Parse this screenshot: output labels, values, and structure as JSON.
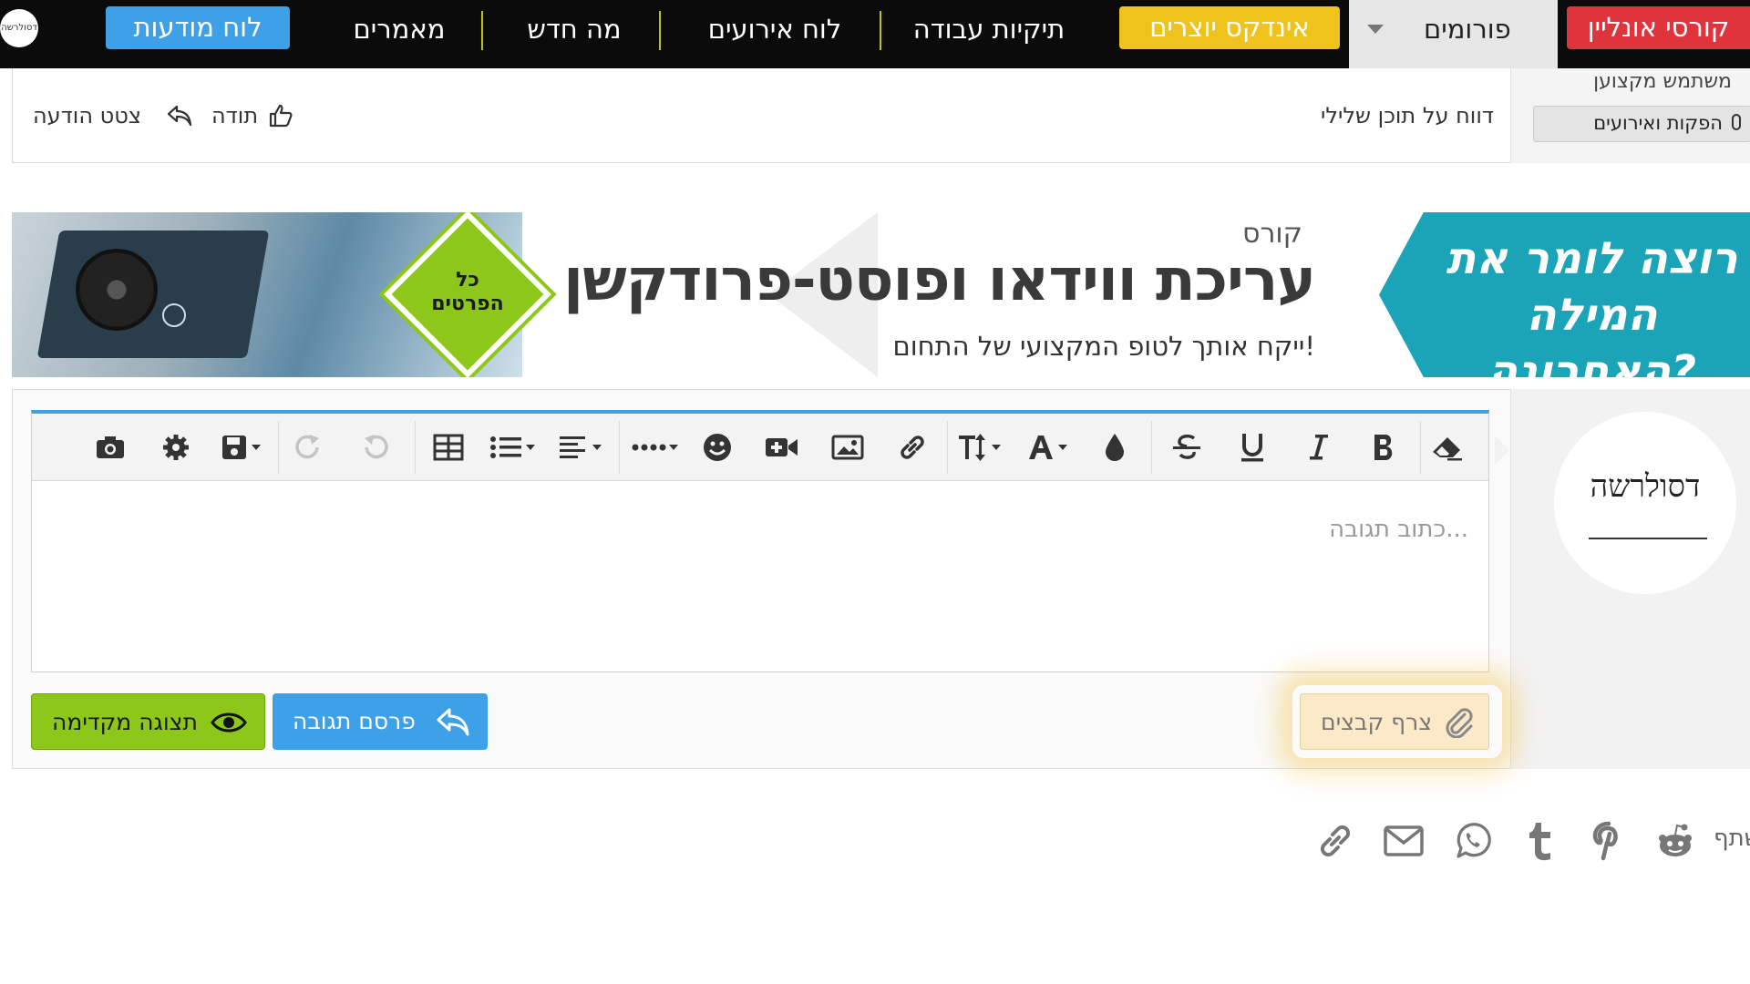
{
  "nav": {
    "logo": "דסולרשה",
    "message_board": "לוח מודעות",
    "articles": "מאמרים",
    "whats_new": "מה חדש",
    "events_board": "לוח אירועים",
    "work_folders": "תיקיות עבודה",
    "creators_index": "אינדקס יוצרים",
    "forums": "פורומים",
    "online_courses": "קורסי אונליין"
  },
  "post_footer": {
    "report": "דווח על תוכן שלילי",
    "thanks": "תודה",
    "quote": "צטט הודעה",
    "user_title": "משתמש מקצוען",
    "user_badge": "הפקות ואירועים"
  },
  "banner": {
    "right_text_line1": "רוצה לומר את",
    "right_text_line2": "המילה האחרונה?",
    "small_label": "קורס",
    "main_title": "עריכת ווידאו ופוסט-פרודקשן",
    "subtitle": "ייקח אותך לטופ המקצועי של התחום!",
    "diamond_text_line1": "כל",
    "diamond_text_line2": "הפרטים"
  },
  "reply": {
    "avatar_label": "דסולרשה",
    "placeholder": "כתוב תגובה...",
    "attach": "צרף קבצים",
    "post_reply": "פרסם תגובה",
    "preview": "תצוגה מקדימה"
  },
  "share": {
    "label": "שתף:"
  },
  "colors": {
    "nav_bg": "#0b0b0b",
    "blue_button": "#3ea0e6",
    "yellow_pill": "#f0c31c",
    "red_pill": "#e0343d",
    "green_button": "#8cc71a",
    "banner_teal": "#1ba3b8"
  }
}
